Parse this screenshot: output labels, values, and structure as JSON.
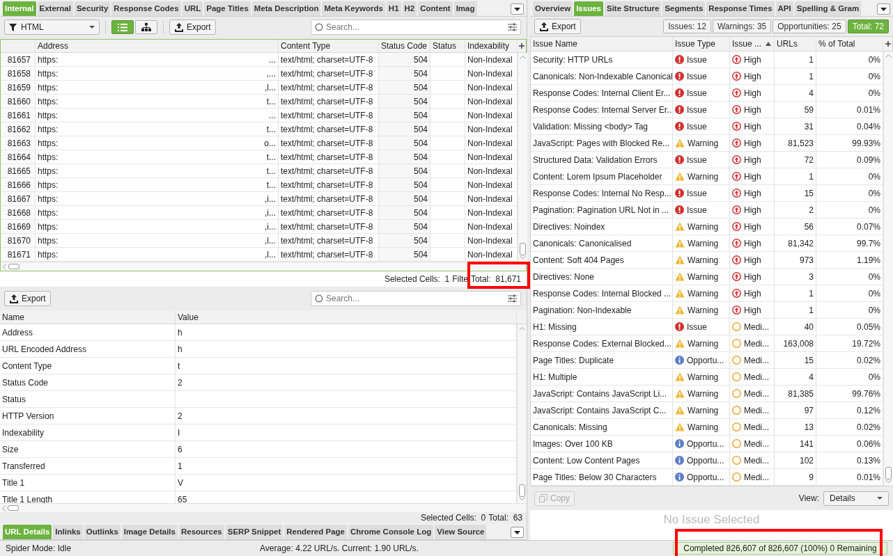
{
  "left_tabs": [
    {
      "label": "Internal",
      "selected": true
    },
    {
      "label": "External",
      "selected": false
    },
    {
      "label": "Security",
      "selected": false
    },
    {
      "label": "Response Codes",
      "selected": false
    },
    {
      "label": "URL",
      "selected": false
    },
    {
      "label": "Page Titles",
      "selected": false
    },
    {
      "label": "Meta Description",
      "selected": false
    },
    {
      "label": "Meta Keywords",
      "selected": false
    },
    {
      "label": "H1",
      "selected": false
    },
    {
      "label": "H2",
      "selected": false
    },
    {
      "label": "Content",
      "selected": false
    },
    {
      "label": "Imag",
      "selected": false
    }
  ],
  "left_toolbar": {
    "filter": "HTML",
    "views": [
      {
        "kind": "list",
        "selected": true
      },
      {
        "kind": "tree",
        "selected": false
      }
    ],
    "export": "Export",
    "search": {
      "placeholder": "Search..."
    }
  },
  "url_table": {
    "columns": [
      "Address",
      "Content Type",
      "Status Code",
      "Status",
      "Indexability"
    ],
    "rows": [
      {
        "index": "81657",
        "address": "https:",
        "address_end": "...",
        "content_type": "text/html; charset=UTF-8",
        "status_code": "504",
        "indexability": "Non-Indexal"
      },
      {
        "index": "81658",
        "address": "https:",
        "address_end": ",...",
        "content_type": "text/html; charset=UTF-8",
        "status_code": "504",
        "indexability": "Non-Indexal"
      },
      {
        "index": "81659",
        "address": "https:",
        "address_end": ",l...",
        "content_type": "text/html; charset=UTF-8",
        "status_code": "504",
        "indexability": "Non-Indexal"
      },
      {
        "index": "81660",
        "address": "https:",
        "address_end": "t...",
        "content_type": "text/html; charset=UTF-8",
        "status_code": "504",
        "indexability": "Non-Indexal"
      },
      {
        "index": "81661",
        "address": "https:",
        "address_end": "...",
        "content_type": "text/html; charset=UTF-8",
        "status_code": "504",
        "indexability": "Non-Indexal"
      },
      {
        "index": "81662",
        "address": "https:",
        "address_end": "t...",
        "content_type": "text/html; charset=UTF-8",
        "status_code": "504",
        "indexability": "Non-Indexal"
      },
      {
        "index": "81663",
        "address": "https:",
        "address_end": "o...",
        "content_type": "text/html; charset=UTF-8",
        "status_code": "504",
        "indexability": "Non-Indexal"
      },
      {
        "index": "81664",
        "address": "https:",
        "address_end": "t...",
        "content_type": "text/html; charset=UTF-8",
        "status_code": "504",
        "indexability": "Non-Indexal"
      },
      {
        "index": "81665",
        "address": "https:",
        "address_end": "t...",
        "content_type": "text/html; charset=UTF-8",
        "status_code": "504",
        "indexability": "Non-Indexal"
      },
      {
        "index": "81666",
        "address": "https:",
        "address_end": "t...",
        "content_type": "text/html; charset=UTF-8",
        "status_code": "504",
        "indexability": "Non-Indexal"
      },
      {
        "index": "81667",
        "address": "https:",
        "address_end": ",i...",
        "content_type": "text/html; charset=UTF-8",
        "status_code": "504",
        "indexability": "Non-Indexal"
      },
      {
        "index": "81668",
        "address": "https:",
        "address_end": ",i...",
        "content_type": "text/html; charset=UTF-8",
        "status_code": "504",
        "indexability": "Non-Indexal"
      },
      {
        "index": "81669",
        "address": "https:",
        "address_end": ",i...",
        "content_type": "text/html; charset=UTF-8",
        "status_code": "504",
        "indexability": "Non-Indexal"
      },
      {
        "index": "81670",
        "address": "https:",
        "address_end": ",l...",
        "content_type": "text/html; charset=UTF-8",
        "status_code": "504",
        "indexability": "Non-Indexal"
      },
      {
        "index": "81671",
        "address": "https:",
        "address_end": ",l...",
        "content_type": "text/html; charset=UTF-8",
        "status_code": "504",
        "indexability": "Non-Indexal"
      }
    ],
    "footer": {
      "selected_cells": "Selected Cells:  1",
      "filter": "Filte",
      "total": "Total:  81,671"
    }
  },
  "details": {
    "export": "Export",
    "search": {
      "placeholder": "Search..."
    },
    "columns": [
      "Name",
      "Value"
    ],
    "rows": [
      {
        "name": "Address",
        "value": "h"
      },
      {
        "name": "URL Encoded Address",
        "value": "h"
      },
      {
        "name": "Content Type",
        "value": "t"
      },
      {
        "name": "Status Code",
        "value": "2"
      },
      {
        "name": "Status"
      },
      {
        "name": "HTTP Version",
        "value": "2"
      },
      {
        "name": "Indexability",
        "value": "I"
      },
      {
        "name": "Size",
        "value": "6"
      },
      {
        "name": "Transferred",
        "value": "1"
      },
      {
        "name": "Title 1",
        "value": "V"
      },
      {
        "name": "Title 1 Length",
        "value": "65"
      }
    ],
    "footer": {
      "selected_cells": "Selected Cells:  0",
      "total": "Total:  63"
    }
  },
  "bottom_tabs": [
    {
      "label": "URL Details",
      "selected": true
    },
    {
      "label": "Inlinks",
      "selected": false
    },
    {
      "label": "Outlinks",
      "selected": false
    },
    {
      "label": "Image Details",
      "selected": false
    },
    {
      "label": "Resources",
      "selected": false
    },
    {
      "label": "SERP Snippet",
      "selected": false
    },
    {
      "label": "Rendered Page",
      "selected": false
    },
    {
      "label": "Chrome Console Log",
      "selected": false
    },
    {
      "label": "View Source",
      "selected": false
    }
  ],
  "right_tabs": [
    {
      "label": "Overview",
      "selected": false
    },
    {
      "label": "Issues",
      "selected": true
    },
    {
      "label": "Site Structure",
      "selected": false
    },
    {
      "label": "Segments",
      "selected": false
    },
    {
      "label": "Response Times",
      "selected": false
    },
    {
      "label": "API",
      "selected": false
    },
    {
      "label": "Spelling & Gram",
      "selected": false
    }
  ],
  "issues_toolbar": {
    "export": "Export",
    "filters": [
      {
        "label": "Issues: 12",
        "selected": false
      },
      {
        "label": "Warnings: 35",
        "selected": false
      },
      {
        "label": "Opportunities: 25",
        "selected": false
      },
      {
        "label": "Total: 72",
        "selected": true
      }
    ]
  },
  "issues_table": {
    "columns": [
      {
        "label": "Issue Name",
        "sorted": false
      },
      {
        "label": "Issue Type",
        "sorted": false
      },
      {
        "label": "Issue ...",
        "sorted": true
      },
      {
        "label": "URLs",
        "sorted": false
      },
      {
        "label": "% of Total",
        "sorted": false
      }
    ],
    "rows": [
      {
        "name": "Security: HTTP URLs",
        "type": {
          "label": "Issue",
          "kind": "issue"
        },
        "priority": {
          "label": "High",
          "kind": "high"
        },
        "urls": "1",
        "percent": "0%"
      },
      {
        "name": "Canonicals: Non-Indexable Canonical",
        "type": {
          "label": "Issue",
          "kind": "issue"
        },
        "priority": {
          "label": "High",
          "kind": "high"
        },
        "urls": "1",
        "percent": "0%"
      },
      {
        "name": "Response Codes: Internal Client Er...",
        "type": {
          "label": "Issue",
          "kind": "issue"
        },
        "priority": {
          "label": "High",
          "kind": "high"
        },
        "urls": "4",
        "percent": "0%"
      },
      {
        "name": "Response Codes: Internal Server Er...",
        "type": {
          "label": "Issue",
          "kind": "issue"
        },
        "priority": {
          "label": "High",
          "kind": "high"
        },
        "urls": "59",
        "percent": "0.01%"
      },
      {
        "name": "Validation: Missing <body> Tag",
        "type": {
          "label": "Issue",
          "kind": "issue"
        },
        "priority": {
          "label": "High",
          "kind": "high"
        },
        "urls": "31",
        "percent": "0.04%"
      },
      {
        "name": "JavaScript: Pages with Blocked Re...",
        "type": {
          "label": "Warning",
          "kind": "warning"
        },
        "priority": {
          "label": "High",
          "kind": "high"
        },
        "urls": "81,523",
        "percent": "99.93%"
      },
      {
        "name": "Structured Data: Validation Errors",
        "type": {
          "label": "Issue",
          "kind": "issue"
        },
        "priority": {
          "label": "High",
          "kind": "high"
        },
        "urls": "72",
        "percent": "0.09%"
      },
      {
        "name": "Content: Lorem Ipsum Placeholder",
        "type": {
          "label": "Warning",
          "kind": "warning"
        },
        "priority": {
          "label": "High",
          "kind": "high"
        },
        "urls": "1",
        "percent": "0%"
      },
      {
        "name": "Response Codes: Internal No Resp...",
        "type": {
          "label": "Issue",
          "kind": "issue"
        },
        "priority": {
          "label": "High",
          "kind": "high"
        },
        "urls": "15",
        "percent": "0%"
      },
      {
        "name": "Pagination: Pagination URL Not in ...",
        "type": {
          "label": "Issue",
          "kind": "issue"
        },
        "priority": {
          "label": "High",
          "kind": "high"
        },
        "urls": "2",
        "percent": "0%"
      },
      {
        "name": "Directives: Noindex",
        "type": {
          "label": "Warning",
          "kind": "warning"
        },
        "priority": {
          "label": "High",
          "kind": "high"
        },
        "urls": "56",
        "percent": "0.07%"
      },
      {
        "name": "Canonicals: Canonicalised",
        "type": {
          "label": "Warning",
          "kind": "warning"
        },
        "priority": {
          "label": "High",
          "kind": "high"
        },
        "urls": "81,342",
        "percent": "99.7%"
      },
      {
        "name": "Content: Soft 404 Pages",
        "type": {
          "label": "Warning",
          "kind": "warning"
        },
        "priority": {
          "label": "High",
          "kind": "high"
        },
        "urls": "973",
        "percent": "1.19%"
      },
      {
        "name": "Directives: None",
        "type": {
          "label": "Warning",
          "kind": "warning"
        },
        "priority": {
          "label": "High",
          "kind": "high"
        },
        "urls": "3",
        "percent": "0%"
      },
      {
        "name": "Response Codes: Internal Blocked ...",
        "type": {
          "label": "Warning",
          "kind": "warning"
        },
        "priority": {
          "label": "High",
          "kind": "high"
        },
        "urls": "1",
        "percent": "0%"
      },
      {
        "name": "Pagination: Non-Indexable",
        "type": {
          "label": "Warning",
          "kind": "warning"
        },
        "priority": {
          "label": "High",
          "kind": "high"
        },
        "urls": "1",
        "percent": "0%"
      },
      {
        "name": "H1: Missing",
        "type": {
          "label": "Issue",
          "kind": "issue"
        },
        "priority": {
          "label": "Medi...",
          "kind": "medium"
        },
        "urls": "40",
        "percent": "0.05%"
      },
      {
        "name": "Response Codes: External Blocked...",
        "type": {
          "label": "Warning",
          "kind": "warning"
        },
        "priority": {
          "label": "Medi...",
          "kind": "medium"
        },
        "urls": "163,008",
        "percent": "19.72%"
      },
      {
        "name": "Page Titles: Duplicate",
        "type": {
          "label": "Opportu...",
          "kind": "opportunity"
        },
        "priority": {
          "label": "Medi...",
          "kind": "medium"
        },
        "urls": "15",
        "percent": "0.02%"
      },
      {
        "name": "H1: Multiple",
        "type": {
          "label": "Warning",
          "kind": "warning"
        },
        "priority": {
          "label": "Medi...",
          "kind": "medium"
        },
        "urls": "4",
        "percent": "0%"
      },
      {
        "name": "JavaScript: Contains JavaScript Li...",
        "type": {
          "label": "Warning",
          "kind": "warning"
        },
        "priority": {
          "label": "Medi...",
          "kind": "medium"
        },
        "urls": "81,385",
        "percent": "99.76%"
      },
      {
        "name": "JavaScript: Contains JavaScript C...",
        "type": {
          "label": "Warning",
          "kind": "warning"
        },
        "priority": {
          "label": "Medi...",
          "kind": "medium"
        },
        "urls": "97",
        "percent": "0.12%"
      },
      {
        "name": "Canonicals: Missing",
        "type": {
          "label": "Warning",
          "kind": "warning"
        },
        "priority": {
          "label": "Medi...",
          "kind": "medium"
        },
        "urls": "13",
        "percent": "0.02%"
      },
      {
        "name": "Images: Over 100 KB",
        "type": {
          "label": "Opportu...",
          "kind": "opportunity"
        },
        "priority": {
          "label": "Medi...",
          "kind": "medium"
        },
        "urls": "141",
        "percent": "0.06%"
      },
      {
        "name": "Content: Low Content Pages",
        "type": {
          "label": "Opportu...",
          "kind": "opportunity"
        },
        "priority": {
          "label": "Medi...",
          "kind": "medium"
        },
        "urls": "102",
        "percent": "0.13%"
      },
      {
        "name": "Page Titles: Below 30 Characters",
        "type": {
          "label": "Opportu...",
          "kind": "opportunity"
        },
        "priority": {
          "label": "Medi...",
          "kind": "medium"
        },
        "urls": "9",
        "percent": "0.01%"
      }
    ]
  },
  "copy_button": {
    "label": "Copy",
    "disabled": true
  },
  "view_select": {
    "label": "View:",
    "value": "Details"
  },
  "empty_message": "No Issue Selected",
  "status_bar": {
    "mode": "Spider Mode: Idle",
    "speed": "Average: 4.22 URL/s. Current: 1.90 URL/s.",
    "progress": "Completed 826,607 of 826,607 (100%) 0 Remaining",
    "level": 1
  }
}
